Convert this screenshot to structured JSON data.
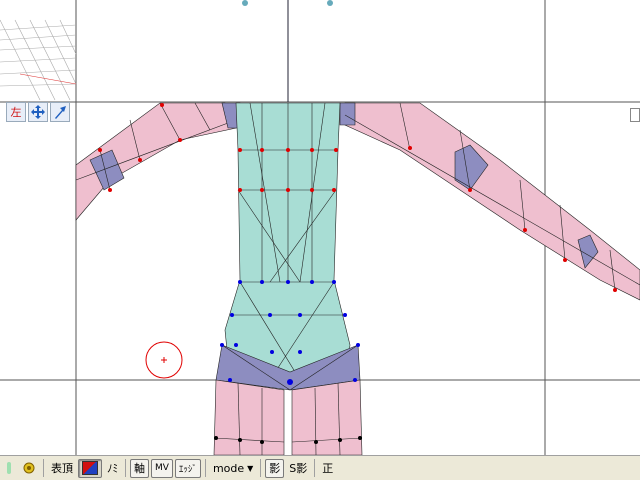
{
  "view_panel": {
    "view_label": "左",
    "move_icon": "move-arrows-icon",
    "rotate_icon": "rotate-arrow-icon"
  },
  "toolbar": {
    "items": [
      {
        "id": "eye-icon",
        "label": ""
      },
      {
        "id": "lock-icon",
        "label": ""
      }
    ],
    "surface_vertex_label": "表頂",
    "material_swatch_icon": "material-color-icon",
    "only_label": "ﾉﾐ",
    "axis_label": "軸",
    "mv_label": "MV",
    "edge_label": "ｴｯｼﾞ",
    "mode_label": "mode",
    "shadow_label": "影",
    "sshadow_label": "S影",
    "front_label": "正"
  },
  "colors": {
    "skin": "#efbfcf",
    "torso": "#a8ddd4",
    "selected": "#8d8dc0",
    "edge": "#202020",
    "vertex_red": "#e00000",
    "vertex_blue": "#0000e0"
  }
}
